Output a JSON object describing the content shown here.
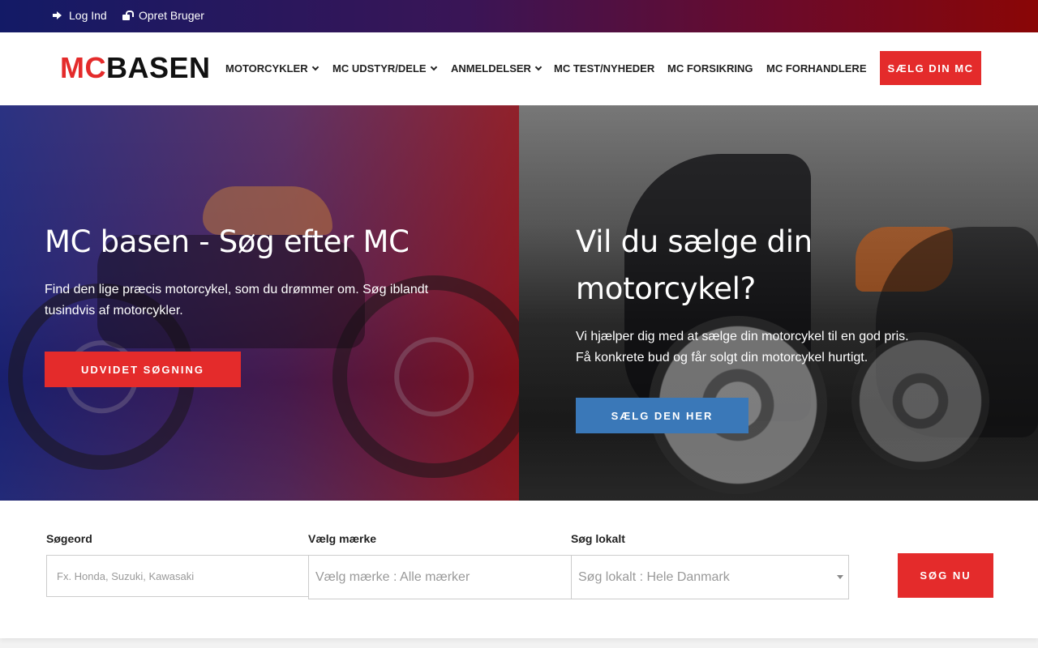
{
  "topbar": {
    "login_label": "Log Ind",
    "login_icon": "sign-in-icon",
    "register_label": "Opret Bruger",
    "register_icon": "unlock-icon"
  },
  "header": {
    "logo_mc": "MC",
    "logo_basen": "BASEN",
    "nav": [
      {
        "label": "MOTORCYKLER",
        "dropdown": true
      },
      {
        "label": "MC UDSTYR/DELE",
        "dropdown": true
      },
      {
        "label": "ANMELDELSER",
        "dropdown": true
      },
      {
        "label": "MC TEST/NYHEDER",
        "dropdown": false
      },
      {
        "label": "MC FORSIKRING",
        "dropdown": false
      },
      {
        "label": "MC FORHANDLERE",
        "dropdown": false
      }
    ],
    "sell_button": "SÆLG DIN MC"
  },
  "hero": {
    "left": {
      "title": "MC basen - Søg efter MC",
      "description": "Find den lige præcis motorcykel, som du drømmer om. Søg iblandt tusindvis af motorcykler.",
      "button": "UDVIDET SØGNING",
      "button_color": "#e42b2b"
    },
    "right": {
      "title": "Vil du sælge din motorcykel?",
      "description": "Vi hjælper dig med at sælge din motorcykel til en god pris. Få konkrete bud og får solgt din motorcykel hurtigt.",
      "button": "SÆLG DEN HER",
      "button_color": "#3a78b8"
    }
  },
  "search": {
    "keyword_label": "Søgeord",
    "keyword_placeholder": "Fx. Honda, Suzuki, Kawasaki",
    "keyword_value": "",
    "brand_label": "Vælg mærke",
    "brand_selected": "Vælg mærke : Alle mærker",
    "location_label": "Søg lokalt",
    "location_selected": "Søg lokalt : Hele Danmark",
    "submit_label": "SØG NU"
  },
  "colors": {
    "accent_red": "#e42b2b",
    "accent_blue": "#3a78b8"
  }
}
